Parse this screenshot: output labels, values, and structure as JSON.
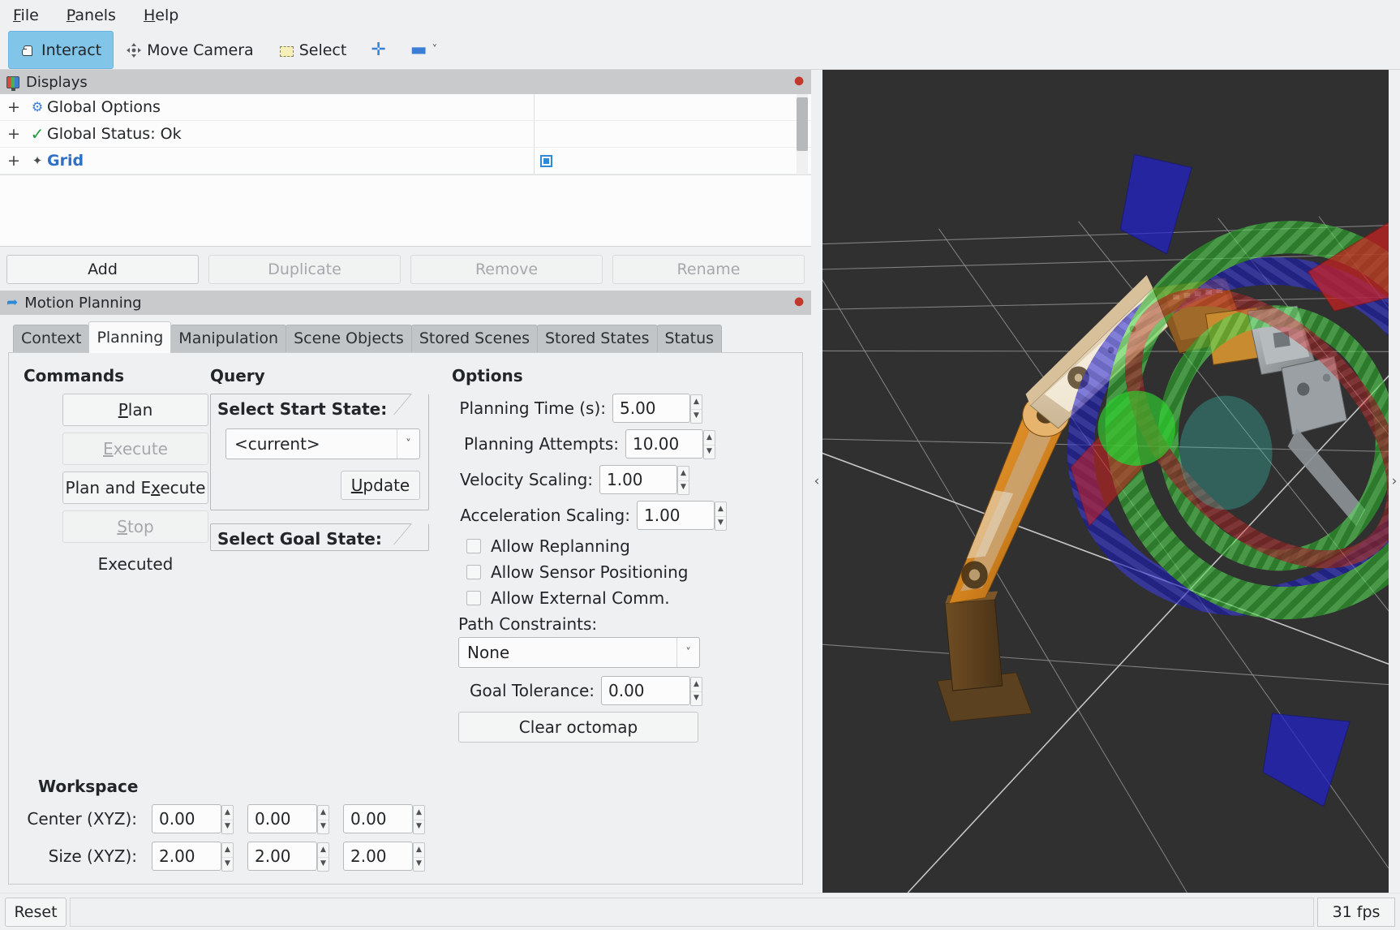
{
  "menubar": {
    "items": [
      {
        "label": "File",
        "accel": "F"
      },
      {
        "label": "Panels",
        "accel": "P"
      },
      {
        "label": "Help",
        "accel": "H"
      }
    ]
  },
  "toolbar": {
    "interact": "Interact",
    "move_camera": "Move Camera",
    "select": "Select",
    "plus_icon": "plus-icon",
    "minus_icon": "minus-icon",
    "chevron_icon": "chevron-down-icon"
  },
  "displays": {
    "title": "Displays",
    "rows": [
      {
        "expander": "+",
        "icon": "gear-icon",
        "label": "Global Options",
        "bold": false,
        "checkbox": false
      },
      {
        "expander": "+",
        "icon": "check-icon",
        "label": "Global Status: Ok",
        "bold": false,
        "checkbox": false
      },
      {
        "expander": "+",
        "icon": "grid-icon",
        "label": "Grid",
        "bold": true,
        "checkbox": true
      }
    ],
    "buttons": {
      "add": "Add",
      "duplicate": "Duplicate",
      "remove": "Remove",
      "rename": "Rename"
    }
  },
  "motion_planning": {
    "title": "Motion Planning",
    "tabs": [
      {
        "label": "Context",
        "active": false
      },
      {
        "label": "Planning",
        "active": true
      },
      {
        "label": "Manipulation",
        "active": false
      },
      {
        "label": "Scene Objects",
        "active": false
      },
      {
        "label": "Stored Scenes",
        "active": false
      },
      {
        "label": "Stored States",
        "active": false
      },
      {
        "label": "Status",
        "active": false
      }
    ],
    "commands": {
      "heading": "Commands",
      "plan": "Plan",
      "execute": "Execute",
      "plan_and_execute": "Plan and Execute",
      "stop": "Stop",
      "status": "Executed"
    },
    "query": {
      "heading": "Query",
      "start_state_label": "Select Start State:",
      "start_state_value": "<current>",
      "update": "Update",
      "goal_state_label": "Select Goal State:"
    },
    "options": {
      "heading": "Options",
      "planning_time_label": "Planning Time (s):",
      "planning_time_value": "5.00",
      "planning_attempts_label": "Planning Attempts:",
      "planning_attempts_value": "10.00",
      "velocity_scaling_label": "Velocity Scaling:",
      "velocity_scaling_value": "1.00",
      "acceleration_scaling_label": "Acceleration Scaling:",
      "acceleration_scaling_value": "1.00",
      "allow_replanning": "Allow Replanning",
      "allow_sensor_positioning": "Allow Sensor Positioning",
      "allow_external_comm": "Allow External Comm.",
      "path_constraints_label": "Path Constraints:",
      "path_constraints_value": "None",
      "goal_tolerance_label": "Goal Tolerance:",
      "goal_tolerance_value": "0.00",
      "clear_octomap": "Clear octomap"
    },
    "workspace": {
      "heading": "Workspace",
      "center_label": "Center (XYZ):",
      "center_values": [
        "0.00",
        "0.00",
        "0.00"
      ],
      "size_label": "Size (XYZ):",
      "size_values": [
        "2.00",
        "2.00",
        "2.00"
      ]
    }
  },
  "viewport": {
    "background_color": "#303030",
    "grid_color": "#9a9a9a",
    "left_handle": "‹",
    "right_handle": "›",
    "marker_colors": {
      "x_axis_red": "#cc2222",
      "y_axis_green": "#22bb22",
      "z_axis_blue": "#2222cc",
      "robot_orange": "#e08a22",
      "robot_cream": "#e8dcc8",
      "robot_brown": "#6b4a22",
      "gripper_grey": "#9aa0a4"
    }
  },
  "statusbar": {
    "reset": "Reset",
    "message": "",
    "fps": "31 fps"
  }
}
